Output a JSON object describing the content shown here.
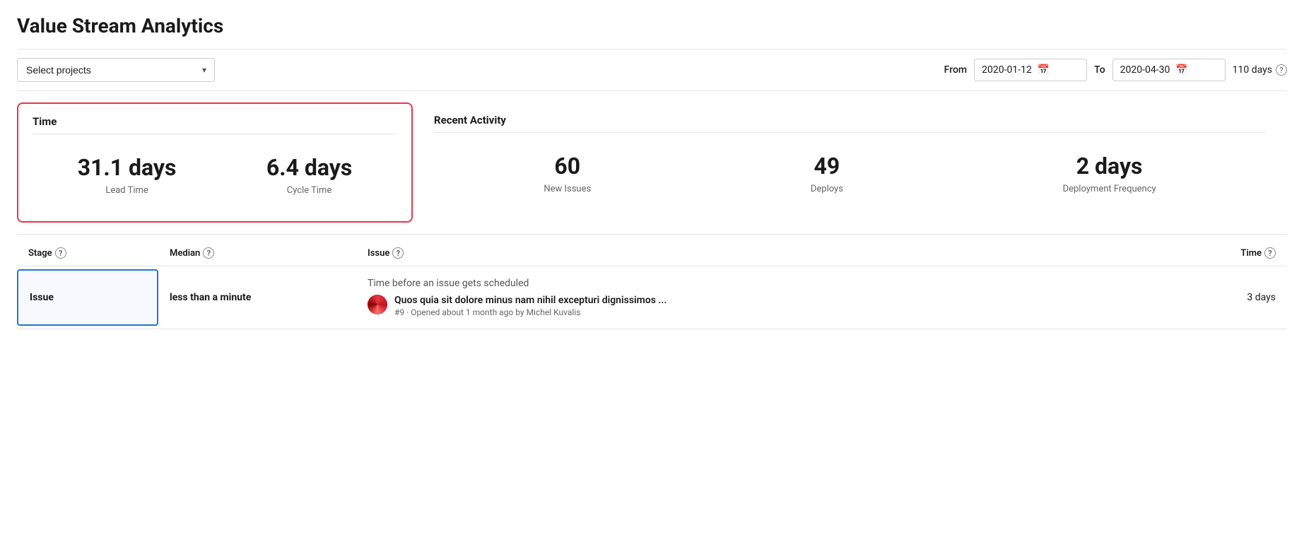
{
  "page": {
    "title": "Value Stream Analytics"
  },
  "topbar": {
    "select_placeholder": "Select projects",
    "from_label": "From",
    "to_label": "To",
    "from_date": "2020-01-12",
    "to_date": "2020-04-30",
    "days": "110 days"
  },
  "time_panel": {
    "title": "Time",
    "lead_time_value": "31.1 days",
    "lead_time_label": "Lead Time",
    "cycle_time_value": "6.4 days",
    "cycle_time_label": "Cycle Time"
  },
  "recent_activity": {
    "title": "Recent Activity",
    "metrics": [
      {
        "value": "60",
        "label": "New Issues"
      },
      {
        "value": "49",
        "label": "Deploys"
      },
      {
        "value": "2 days",
        "label": "Deployment Frequency"
      }
    ]
  },
  "table": {
    "headers": [
      {
        "label": "Stage",
        "help": true
      },
      {
        "label": "Median",
        "help": true
      },
      {
        "label": "Issue",
        "help": true
      },
      {
        "label": "Time",
        "help": true,
        "align": "right"
      }
    ],
    "rows": [
      {
        "stage": "Issue",
        "median": "less than a minute",
        "issue_description": "Time before an issue gets scheduled",
        "issue_title": "Quos quia sit dolore minus nam nihil excepturi dignissimos ...",
        "issue_meta": "#9 · Opened about 1 month ago by Michel Kuvalis",
        "time": "3 days"
      }
    ]
  },
  "icons": {
    "chevron_down": "▾",
    "calendar": "📅",
    "help": "?"
  }
}
